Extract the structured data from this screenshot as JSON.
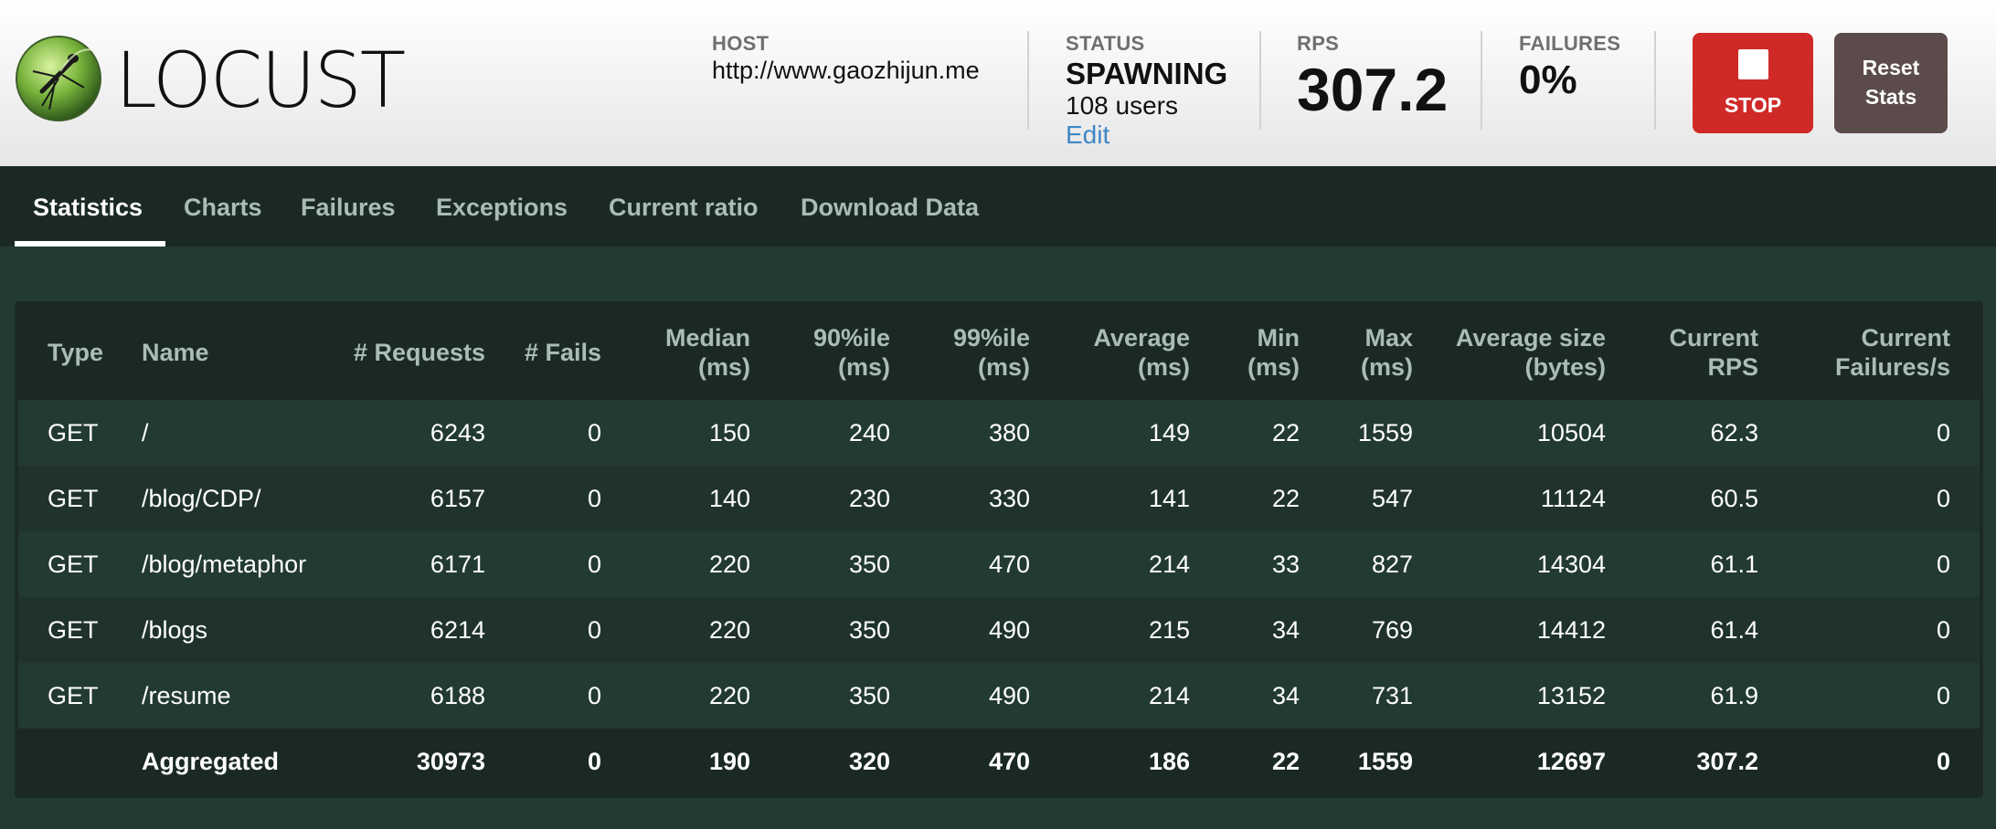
{
  "app": {
    "logo_text": "LOCUST",
    "logo_icon": "locust-logo-icon"
  },
  "header": {
    "host_label": "HOST",
    "host_value": "http://www.gaozhijun.me",
    "status_label": "STATUS",
    "status_value": "SPAWNING",
    "users_value": "108 users",
    "edit_label": "Edit",
    "rps_label": "RPS",
    "rps_value": "307.2",
    "failures_label": "FAILURES",
    "failures_value": "0%",
    "stop_label": "STOP",
    "reset_label_line1": "Reset",
    "reset_label_line2": "Stats"
  },
  "colors": {
    "stop": "#cf2a28",
    "reset": "#5b4b4b",
    "accent_link": "#3f87c6",
    "background": "#223a32"
  },
  "tabs": [
    {
      "label": "Statistics",
      "active": true
    },
    {
      "label": "Charts"
    },
    {
      "label": "Failures"
    },
    {
      "label": "Exceptions"
    },
    {
      "label": "Current ratio"
    },
    {
      "label": "Download Data"
    }
  ],
  "table": {
    "headers": [
      [
        "Type",
        ""
      ],
      [
        "Name",
        ""
      ],
      [
        "# Requests",
        ""
      ],
      [
        "# Fails",
        ""
      ],
      [
        "Median",
        "(ms)"
      ],
      [
        "90%ile",
        "(ms)"
      ],
      [
        "99%ile",
        "(ms)"
      ],
      [
        "Average",
        "(ms)"
      ],
      [
        "Min",
        "(ms)"
      ],
      [
        "Max",
        "(ms)"
      ],
      [
        "Average size",
        "(bytes)"
      ],
      [
        "Current",
        "RPS"
      ],
      [
        "Current",
        "Failures/s"
      ]
    ],
    "rows": [
      [
        "GET",
        "/",
        "6243",
        "0",
        "150",
        "240",
        "380",
        "149",
        "22",
        "1559",
        "10504",
        "62.3",
        "0"
      ],
      [
        "GET",
        "/blog/CDP/",
        "6157",
        "0",
        "140",
        "230",
        "330",
        "141",
        "22",
        "547",
        "11124",
        "60.5",
        "0"
      ],
      [
        "GET",
        "/blog/metaphor",
        "6171",
        "0",
        "220",
        "350",
        "470",
        "214",
        "33",
        "827",
        "14304",
        "61.1",
        "0"
      ],
      [
        "GET",
        "/blogs",
        "6214",
        "0",
        "220",
        "350",
        "490",
        "215",
        "34",
        "769",
        "14412",
        "61.4",
        "0"
      ],
      [
        "GET",
        "/resume",
        "6188",
        "0",
        "220",
        "350",
        "490",
        "214",
        "34",
        "731",
        "13152",
        "61.9",
        "0"
      ]
    ],
    "aggregated": [
      "",
      "Aggregated",
      "30973",
      "0",
      "190",
      "320",
      "470",
      "186",
      "22",
      "1559",
      "12697",
      "307.2",
      "0"
    ]
  }
}
